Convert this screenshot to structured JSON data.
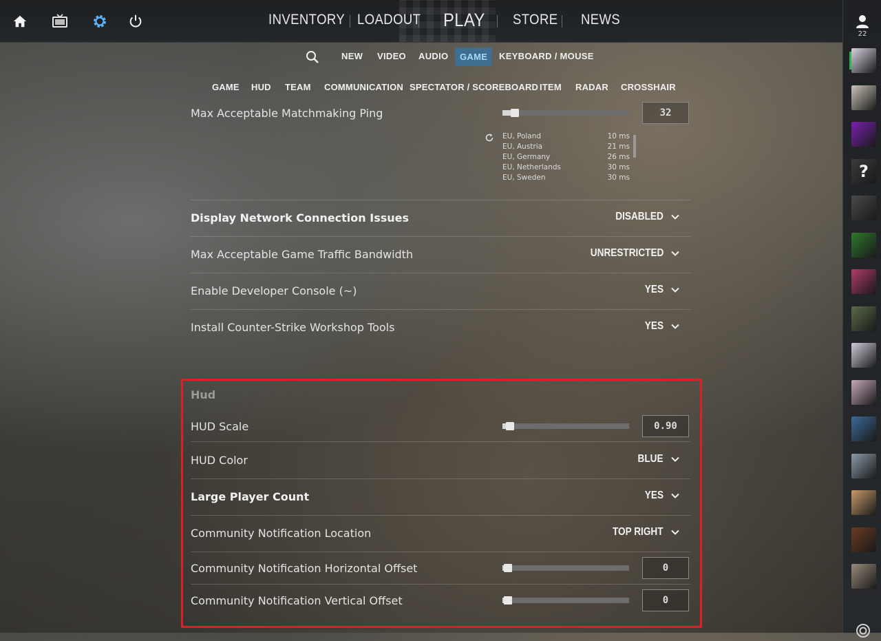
{
  "topbar": {
    "nav": [
      "INVENTORY",
      "LOADOUT",
      "PLAY",
      "STORE",
      "NEWS"
    ]
  },
  "subnav": {
    "tabs": [
      "NEW",
      "VIDEO",
      "AUDIO",
      "GAME",
      "KEYBOARD / MOUSE"
    ],
    "active": "GAME"
  },
  "subnav2": {
    "tabs": [
      "GAME",
      "HUD",
      "TEAM",
      "COMMUNICATION",
      "SPECTATOR / SCOREBOARD",
      "ITEM",
      "RADAR",
      "CROSSHAIR"
    ]
  },
  "settings": {
    "ping": {
      "label": "Max Acceptable Matchmaking Ping",
      "value": "32",
      "slider_fraction": 0.06
    },
    "servers": [
      {
        "name": "EU, Poland",
        "ms": "10 ms"
      },
      {
        "name": "EU, Austria",
        "ms": "21 ms"
      },
      {
        "name": "EU, Germany",
        "ms": "26 ms"
      },
      {
        "name": "EU, Netherlands",
        "ms": "30 ms"
      },
      {
        "name": "EU, Sweden",
        "ms": "30 ms"
      }
    ],
    "network_issues": {
      "label": "Display Network Connection Issues",
      "value": "DISABLED"
    },
    "bandwidth": {
      "label": "Max Acceptable Game Traffic Bandwidth",
      "value": "UNRESTRICTED"
    },
    "dev_console": {
      "label": "Enable Developer Console (~)",
      "value": "YES"
    },
    "workshop": {
      "label": "Install Counter-Strike Workshop Tools",
      "value": "YES"
    }
  },
  "hud": {
    "title": "Hud",
    "scale": {
      "label": "HUD Scale",
      "value": "0.90",
      "slider_fraction": 0.02
    },
    "color": {
      "label": "HUD Color",
      "value": "BLUE"
    },
    "large_player_count": {
      "label": "Large Player Count",
      "value": "YES"
    },
    "notif_location": {
      "label": "Community Notification Location",
      "value": "TOP RIGHT"
    },
    "notif_h_offset": {
      "label": "Community Notification Horizontal Offset",
      "value": "0",
      "slider_fraction": 0.0
    },
    "notif_v_offset": {
      "label": "Community Notification Vertical Offset",
      "value": "0",
      "slider_fraction": 0.0
    }
  },
  "sidebar": {
    "friend_count": "22",
    "avatars": [
      {
        "name": "anime-white-hair",
        "color": "#d8d2e0"
      },
      {
        "name": "person-photo",
        "color": "#c9c3b8"
      },
      {
        "name": "neon-smiley",
        "color": "#7a1fb0"
      },
      {
        "name": "unknown",
        "color": "#3a3a3a"
      },
      {
        "name": "cat-black",
        "color": "#4a4a4a"
      },
      {
        "name": "green-helmet",
        "color": "#2f7a2c"
      },
      {
        "name": "anime-hero",
        "color": "#b03a6a"
      },
      {
        "name": "group-photo",
        "color": "#5a6a48"
      },
      {
        "name": "anime-white-hair-2",
        "color": "#d0cad8"
      },
      {
        "name": "anime-girl",
        "color": "#c4a8b8"
      },
      {
        "name": "pixel-art",
        "color": "#3a6a9a"
      },
      {
        "name": "person-selfie",
        "color": "#8a9aa8"
      },
      {
        "name": "cat-orange",
        "color": "#c89a6a"
      },
      {
        "name": "dog-photo",
        "color": "#6a3a22"
      },
      {
        "name": "people-photo",
        "color": "#9a8a7a"
      }
    ]
  },
  "colors": {
    "accent": "#3f6e8e",
    "highlight_box": "#e01e25",
    "online": "#2fb34a"
  }
}
